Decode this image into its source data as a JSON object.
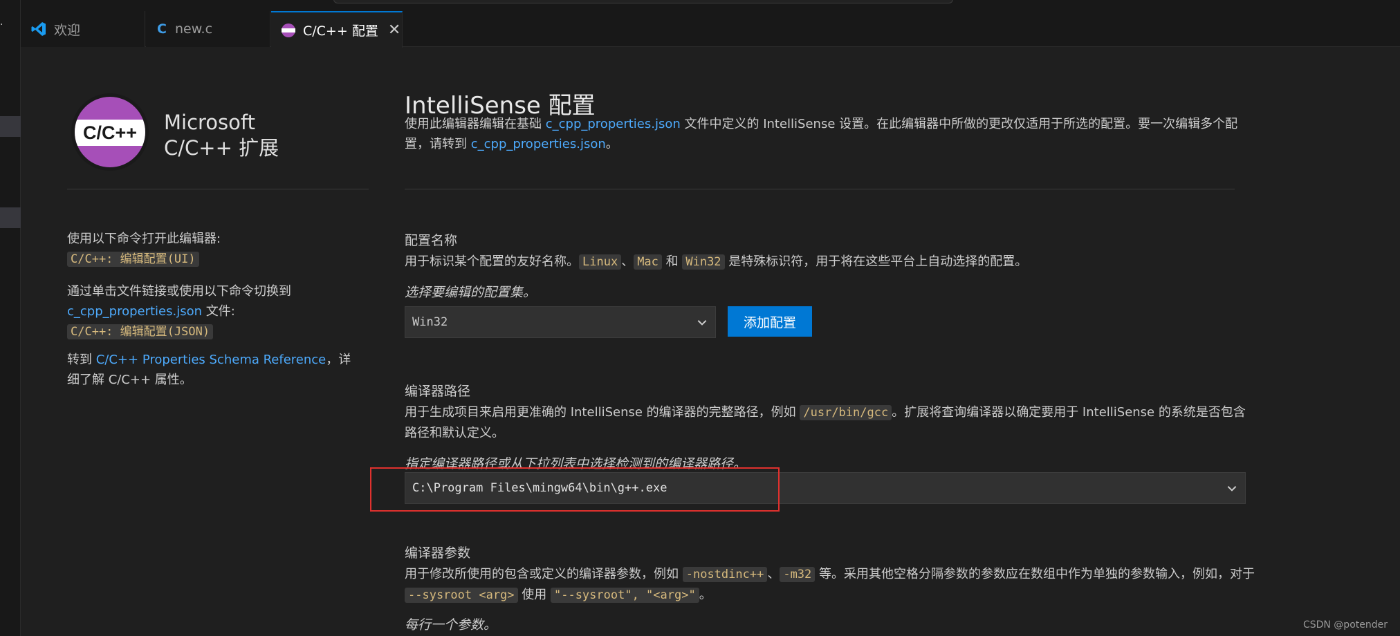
{
  "activity_bar": {
    "more_glyph": "·"
  },
  "tabs": [
    {
      "label": "欢迎",
      "icon": "vscode-icon"
    },
    {
      "label": "new.c",
      "icon": "c-file-icon",
      "glyph": "C"
    },
    {
      "label": "C/C++ 配置",
      "icon": "cpp-extension-icon",
      "close": "✕"
    }
  ],
  "left": {
    "logo_text": "C/C++",
    "brand_line1": "Microsoft",
    "brand_line2": "C/C++ 扩展",
    "open_label": "使用以下命令打开此编辑器:",
    "open_cmd": "C/C++: 编辑配置(UI)",
    "switch_label": "通过单击文件链接或使用以下命令切换到",
    "switch_link": "c_cpp_properties.json",
    "switch_suffix": " 文件:",
    "switch_cmd": "C/C++: 编辑配置(JSON)",
    "goto_prefix": "转到 ",
    "goto_link": "C/C++ Properties Schema Reference",
    "goto_suffix": "，详细了解 C/C++ 属性。"
  },
  "main": {
    "title": "IntelliSense 配置",
    "desc_a": "使用此编辑器编辑在基础 ",
    "desc_link1": "c_cpp_properties.json",
    "desc_b": " 文件中定义的 IntelliSense 设置。在此编辑器中所做的更改仅适用于所选的配置。要一次编辑多个配置，请转到 ",
    "desc_link2": "c_cpp_properties.json",
    "desc_c": "。",
    "config_name": {
      "title": "配置名称",
      "desc_a": "用于标识某个配置的友好名称。",
      "code1": "Linux",
      "sep1": "、",
      "code2": "Mac",
      "sep2": " 和 ",
      "code3": "Win32",
      "desc_b": " 是特殊标识符，用于将在这些平台上自动选择的配置。",
      "hint": "选择要编辑的配置集。",
      "selected": "Win32",
      "add_button": "添加配置"
    },
    "compiler_path": {
      "title": "编译器路径",
      "desc_a": "用于生成项目来启用更准确的 IntelliSense 的编译器的完整路径，例如 ",
      "code1": "/usr/bin/gcc",
      "desc_b": "。扩展将查询编译器以确定要用于 IntelliSense 的系统是否包含路径和默认定义。",
      "hint": "指定编译器路径或从下拉列表中选择检测到的编译器路径。",
      "value": "C:\\Program Files\\mingw64\\bin\\g++.exe"
    },
    "compiler_args": {
      "title": "编译器参数",
      "desc_a": "用于修改所使用的包含或定义的编译器参数，例如 ",
      "code1": "-nostdinc++",
      "sep1": "、",
      "code2": "-m32",
      "desc_b": " 等。采用其他空格分隔参数的参数应在数组中作为单独的参数输入，例如，对于 ",
      "code3": "--sysroot <arg>",
      "desc_c": " 使用 ",
      "code4": "\"--sysroot\", \"<arg>\"",
      "desc_d": "。",
      "hint": "每行一个参数。"
    }
  },
  "watermark": "CSDN @potender",
  "colors": {
    "accent": "#0078d4",
    "link": "#4daafc",
    "code_text": "#d7ba7d",
    "highlight_box": "#e0312e",
    "logo_purple": "#a64fb8"
  }
}
